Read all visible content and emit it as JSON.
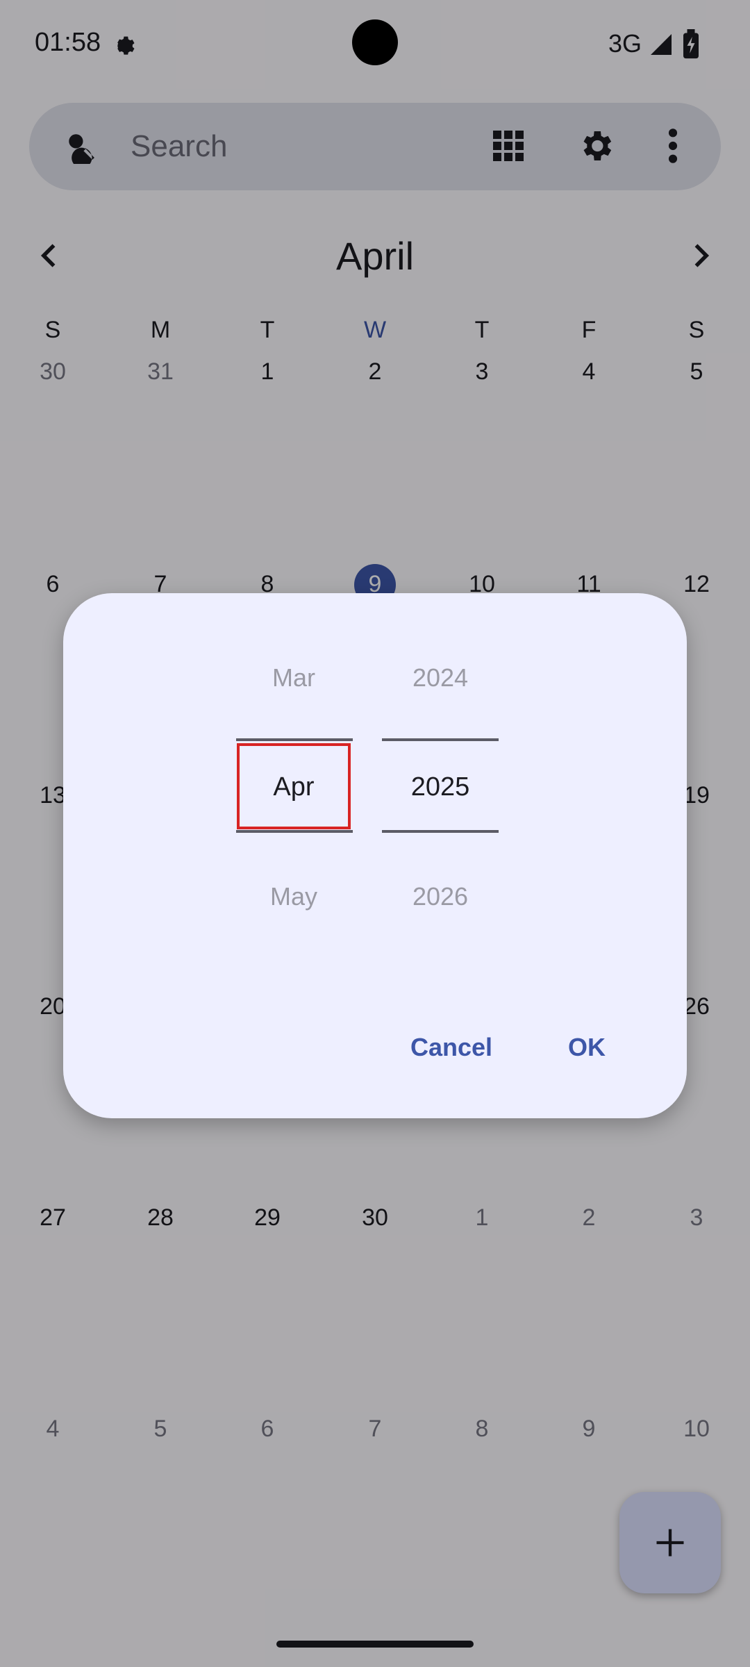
{
  "status_bar": {
    "time": "01:58",
    "network": "3G"
  },
  "search": {
    "placeholder": "Search"
  },
  "calendar": {
    "month": "April",
    "weekdays": [
      "S",
      "M",
      "T",
      "W",
      "T",
      "F",
      "S"
    ],
    "week1": [
      "30",
      "31",
      "1",
      "2",
      "3",
      "4",
      "5"
    ],
    "week2": [
      "6",
      "7",
      "8",
      "9",
      "10",
      "11",
      "12"
    ],
    "week3": [
      "13",
      "",
      "",
      "",
      "",
      "",
      "19"
    ],
    "week4": [
      "20",
      "",
      "",
      "",
      "",
      "",
      "26"
    ],
    "week5": [
      "27",
      "28",
      "29",
      "30",
      "1",
      "2",
      "3"
    ],
    "week6": [
      "4",
      "5",
      "6",
      "7",
      "8",
      "9",
      "10"
    ],
    "today": "9"
  },
  "dialog": {
    "months": [
      "Mar",
      "Apr",
      "May"
    ],
    "years": [
      "2024",
      "2025",
      "2026"
    ],
    "cancel_label": "Cancel",
    "ok_label": "OK"
  },
  "colors": {
    "accent": "#3d56a8",
    "focus": "#d82424"
  }
}
